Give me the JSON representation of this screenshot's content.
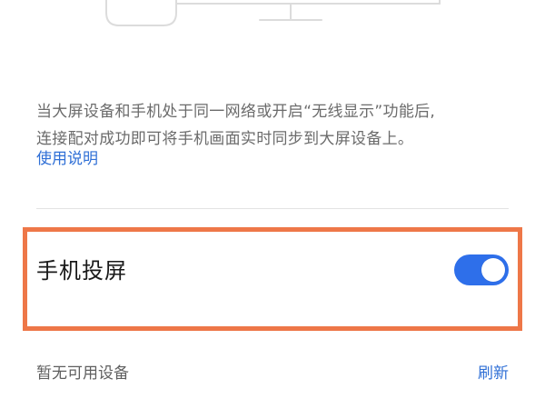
{
  "illustration": {
    "icon": "phone-to-monitor-illustration"
  },
  "description": {
    "line1": "当大屏设备和手机处于同一网络或开启“无线显示”功能后,",
    "line2": "连接配对成功即可将手机画面实时同步到大屏设备上。"
  },
  "help_link": "使用说明",
  "screen_cast": {
    "label": "手机投屏",
    "toggle_on": true,
    "toggle_color": "#2e6fea",
    "highlight_color": "#ee7748"
  },
  "devices": {
    "status": "暂无可用设备",
    "refresh_label": "刷新"
  }
}
